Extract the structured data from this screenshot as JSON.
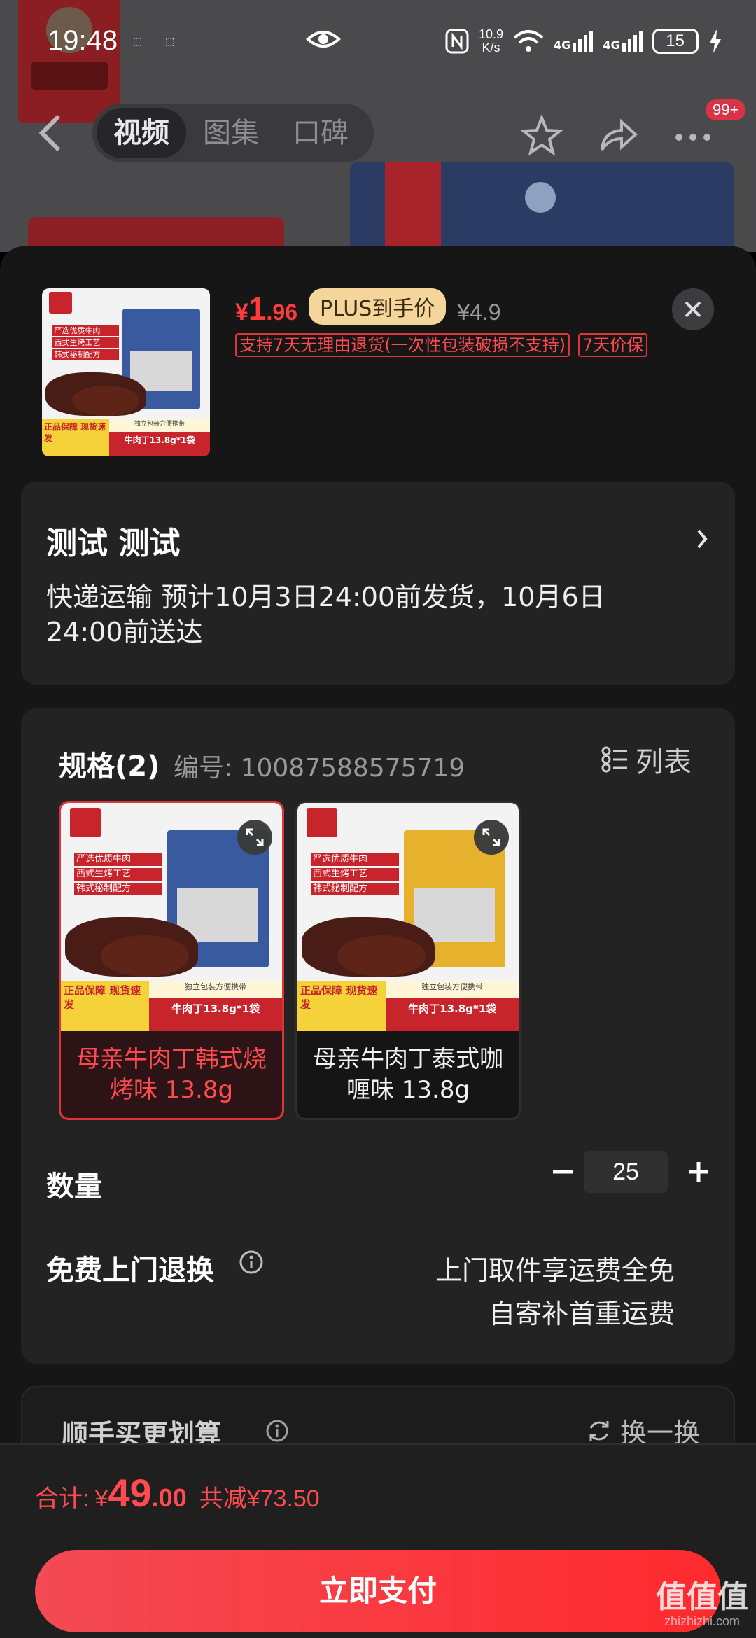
{
  "status_bar": {
    "time": "19:48",
    "net_speed_top": "10.9",
    "net_speed_bottom": "K/s",
    "net1": "4G",
    "net2": "4G",
    "battery": "15"
  },
  "nav": {
    "tabs": [
      "视频",
      "图集",
      "口碑"
    ],
    "active_tab": "视频",
    "badge": "99+"
  },
  "product": {
    "price_currency": "¥",
    "price_int": "1",
    "price_dec": ".96",
    "plus_label": "PLUS到手价",
    "original_price": "¥4.9",
    "tags": [
      "支持7天无理由退货(一次性包装破损不支持)",
      "7天价保"
    ],
    "image_labels": [
      "严选优质牛肉",
      "西式生烤工艺",
      "韩式秘制配方"
    ],
    "image_guarantee": "正品保障 现货速发",
    "image_tagline": "独立包装方便携带",
    "image_bar": "牛肉丁13.8g*1袋"
  },
  "address": {
    "name": "测试  测试",
    "delivery": "快递运输 预计10月3日24:00前发货，10月6日24:00前送达"
  },
  "spec": {
    "title": "规格(2)",
    "code": "编号: 10087588575719",
    "list_label": "列表",
    "variants": [
      {
        "label": "母亲牛肉丁韩式烧烤味 13.8g",
        "selected": true,
        "pack_color": "#3a5aa0"
      },
      {
        "label": "母亲牛肉丁泰式咖喱味 13.8g",
        "selected": false,
        "pack_color": "#e6b22e"
      }
    ]
  },
  "quantity": {
    "label": "数量",
    "value": "25"
  },
  "returns": {
    "label": "免费上门退换",
    "line1": "上门取件享运费全免",
    "line2": "自寄补首重运费"
  },
  "more": {
    "title": "顺手买更划算",
    "swap_label": "换一换"
  },
  "summary": {
    "total_label": "合计:",
    "currency": "¥",
    "total_int": "49",
    "total_dec": ".00",
    "savings": "共减¥73.50",
    "pay_label": "立即支付"
  },
  "watermark": {
    "top": "值值值",
    "sub": "zhizhizhi.com"
  },
  "colors": {
    "accent": "#ff3b3b",
    "sheet_bg": "#161616",
    "card_bg": "#232323",
    "plus_badge": "#f4d69b"
  }
}
